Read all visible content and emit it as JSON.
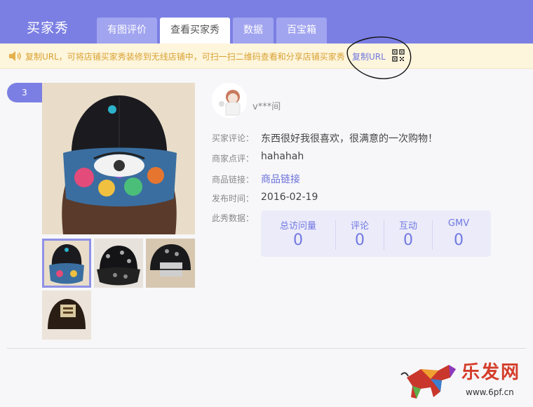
{
  "header": {
    "brand": "买家秀",
    "tabs": [
      {
        "label": "有图评价",
        "active": false
      },
      {
        "label": "查看买家秀",
        "active": true
      },
      {
        "label": "数据",
        "active": false
      },
      {
        "label": "百宝箱",
        "active": false
      }
    ]
  },
  "notice": {
    "text": "复制URL，可将店铺买家秀装修到无线店铺中，可扫一扫二维码查看和分享店铺买家秀",
    "copy_link": "复制URL",
    "icon": "speaker-icon",
    "qr_icon": "qr-code-icon"
  },
  "post": {
    "index": "3",
    "username": "v***间",
    "fields": [
      {
        "label": "买家评论：",
        "value": "东西很好我很喜欢，很满意的一次购物！"
      },
      {
        "label": "商家点评：",
        "value": "hahahah"
      },
      {
        "label": "商品链接：",
        "value": "商品链接"
      },
      {
        "label": "发布时间：",
        "value": "2016-02-19"
      },
      {
        "label": "此秀数据：",
        "value": ""
      }
    ],
    "stats": [
      {
        "label": "总访问量",
        "value": "0"
      },
      {
        "label": "评论",
        "value": "0"
      },
      {
        "label": "互动",
        "value": "0"
      },
      {
        "label": "GMV",
        "value": "0"
      }
    ]
  },
  "watermark": {
    "logo_text": "乐发网",
    "url": "www.6pf.cn"
  },
  "colors": {
    "accent": "#7b7fe3",
    "tab_inactive": "#a1a4ef",
    "notice_bg": "#fdf5dc",
    "notice_text": "#d9a233",
    "link": "#7178e1",
    "stats_bg": "#ebebfa"
  }
}
